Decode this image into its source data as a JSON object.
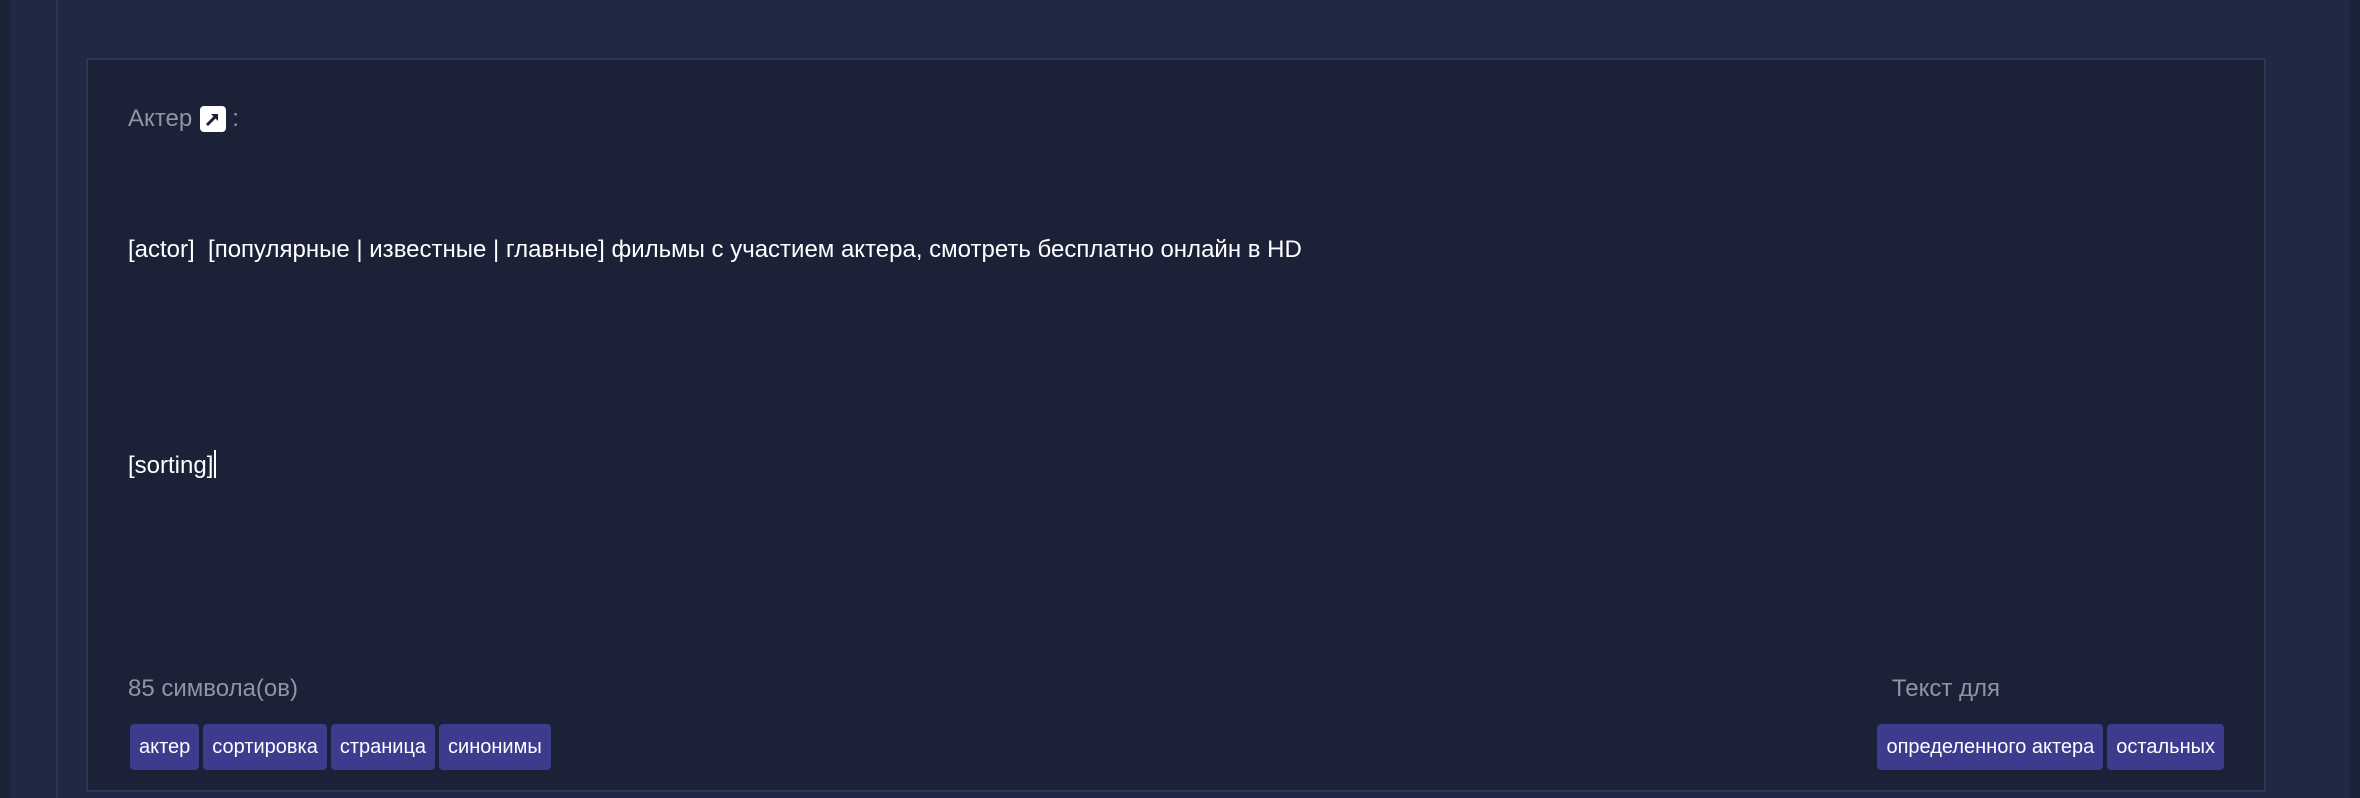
{
  "field": {
    "label": "Актер",
    "label_suffix": ":",
    "icon": "external-link-icon"
  },
  "editor": {
    "line1": "[actor]  [популярные | известные | главные] фильмы с участием актера, смотреть бесплатно онлайн в HD",
    "line2": "[sorting]"
  },
  "char_count": "85 символа(ов)",
  "variables": [
    "актер",
    "сортировка",
    "страница",
    "синонимы"
  ],
  "text_for": {
    "label": "Текст для",
    "options": [
      "определенного актера",
      "остальных"
    ]
  },
  "colors": {
    "tag_bg": "#3d3b8e",
    "panel_bg": "#1b2137",
    "page_bg": "#1f2944"
  }
}
